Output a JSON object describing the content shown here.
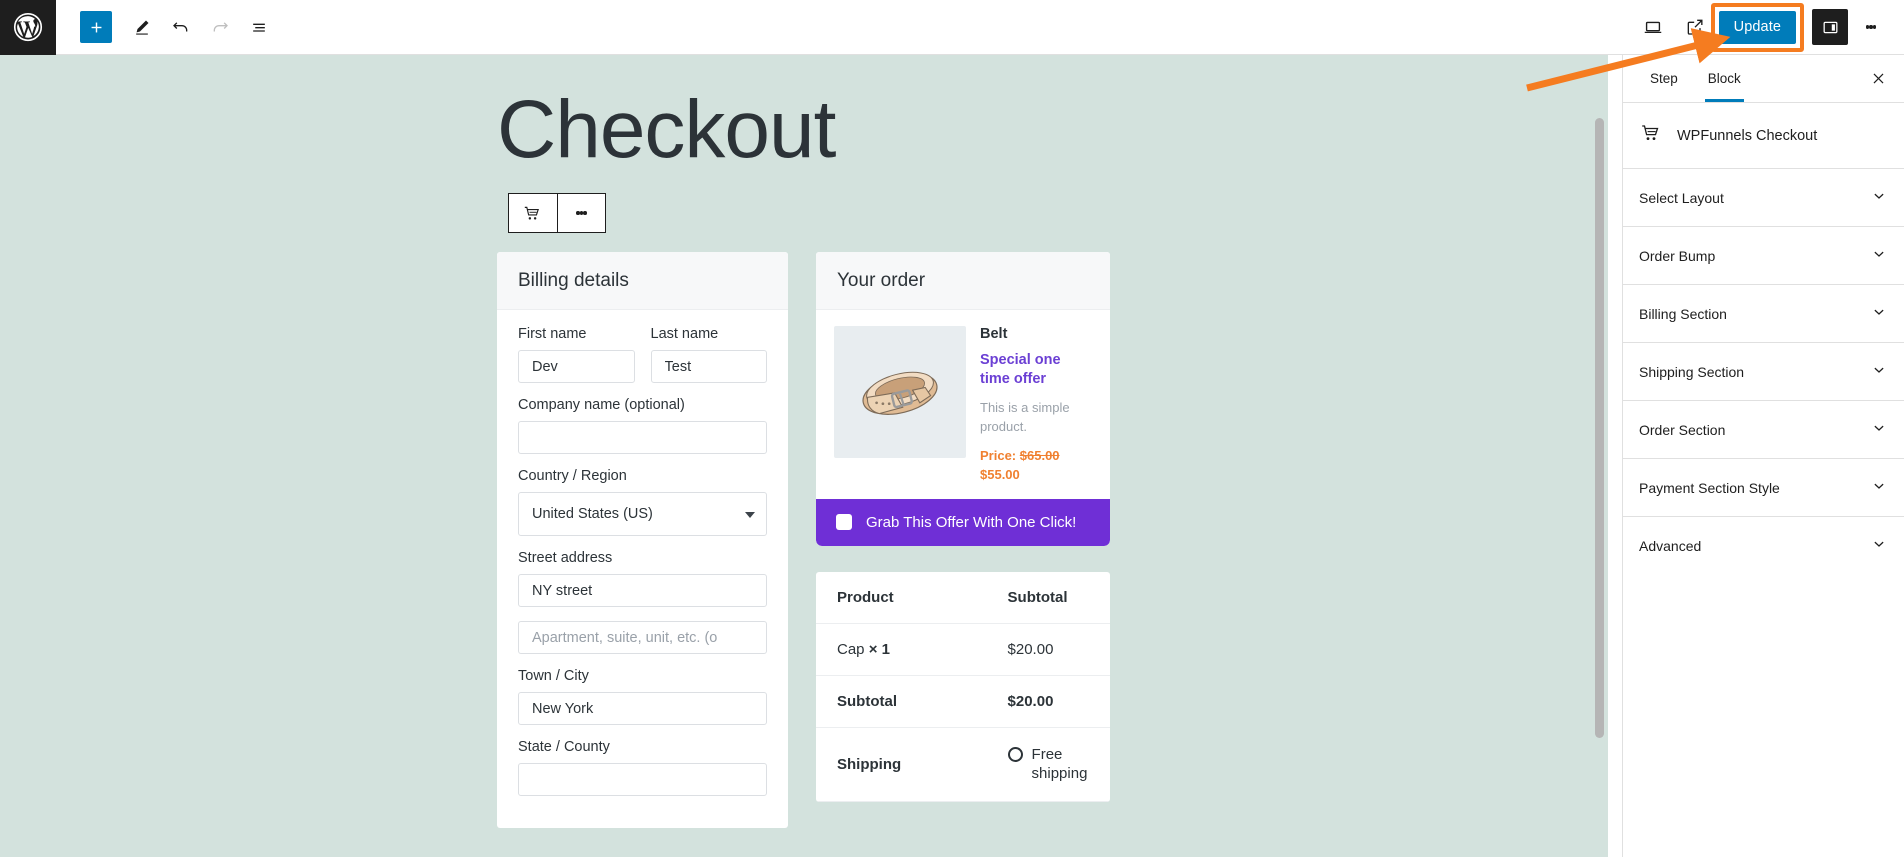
{
  "topbar": {
    "logo_icon": "wordpress-logo-icon",
    "tools": [
      {
        "name": "add-block-button",
        "icon": "plus-icon",
        "label": "Add block"
      },
      {
        "name": "edit-tool-button",
        "icon": "pencil-icon",
        "label": "Edit"
      },
      {
        "name": "undo-button",
        "icon": "undo-arrow-icon",
        "label": "Undo"
      },
      {
        "name": "redo-button",
        "icon": "redo-arrow-icon",
        "label": "Redo"
      },
      {
        "name": "list-view-button",
        "icon": "list-view-icon",
        "label": "List view"
      }
    ],
    "view_icon": "laptop-preview-icon",
    "external_icon": "external-link-icon",
    "update_label": "Update",
    "sidebar_toggle_icon": "settings-panel-icon",
    "options_icon": "kebab-menu-icon",
    "highlight_color": "#f57c20",
    "accent_color": "#007cba"
  },
  "canvas": {
    "background_color": "#d3e2dd",
    "page_title": "Checkout",
    "block_toolbar": {
      "cart_icon": "shopping-cart-icon",
      "options_icon": "kebab-menu-icon"
    },
    "billing": {
      "heading": "Billing details",
      "first_name": {
        "label": "First name",
        "value": "Dev"
      },
      "last_name": {
        "label": "Last name",
        "value": "Test"
      },
      "company": {
        "label": "Company name (optional)",
        "value": "",
        "placeholder": ""
      },
      "country": {
        "label": "Country / Region",
        "value": "United States (US)"
      },
      "street": {
        "label": "Street address",
        "value": "NY street"
      },
      "street2": {
        "value": "",
        "placeholder": "Apartment, suite, unit, etc. (o"
      },
      "city": {
        "label": "Town / City",
        "value": "New York"
      },
      "state": {
        "label": "State / County",
        "value": ""
      }
    },
    "order": {
      "heading": "Your order",
      "bump": {
        "product_title": "Belt",
        "offer_text": "Special one time offer",
        "description": "This is a simple product.",
        "price_label": "Price:",
        "price_old": "$65.00",
        "price_new": "$55.00",
        "cta_label": "Grab This Offer With One Click!",
        "cta_color": "#6f2fd6",
        "offer_color": "#6b3fd4",
        "price_color": "#f08030",
        "image_alt": "belt-product-image"
      },
      "table": {
        "headers": [
          "Product",
          "Subtotal"
        ],
        "rows": [
          {
            "label": "Cap",
            "qty": "× 1",
            "amount": "$20.00",
            "strong": false
          },
          {
            "label": "Subtotal",
            "qty": "",
            "amount": "$20.00",
            "strong": true
          }
        ],
        "shipping": {
          "label": "Shipping",
          "option": "Free shipping",
          "selected": false
        }
      }
    }
  },
  "sidebar": {
    "tabs": [
      {
        "label": "Step",
        "active": false
      },
      {
        "label": "Block",
        "active": true
      }
    ],
    "close_icon": "close-icon",
    "block": {
      "icon": "shopping-cart-icon",
      "name": "WPFunnels Checkout"
    },
    "panels": [
      {
        "label": "Select Layout",
        "icon": "chevron-down-icon"
      },
      {
        "label": "Order Bump",
        "icon": "chevron-down-icon"
      },
      {
        "label": "Billing Section",
        "icon": "chevron-down-icon"
      },
      {
        "label": "Shipping Section",
        "icon": "chevron-down-icon"
      },
      {
        "label": "Order Section",
        "icon": "chevron-down-icon"
      },
      {
        "label": "Payment Section Style",
        "icon": "chevron-down-icon"
      },
      {
        "label": "Advanced",
        "icon": "chevron-down-icon"
      }
    ]
  }
}
